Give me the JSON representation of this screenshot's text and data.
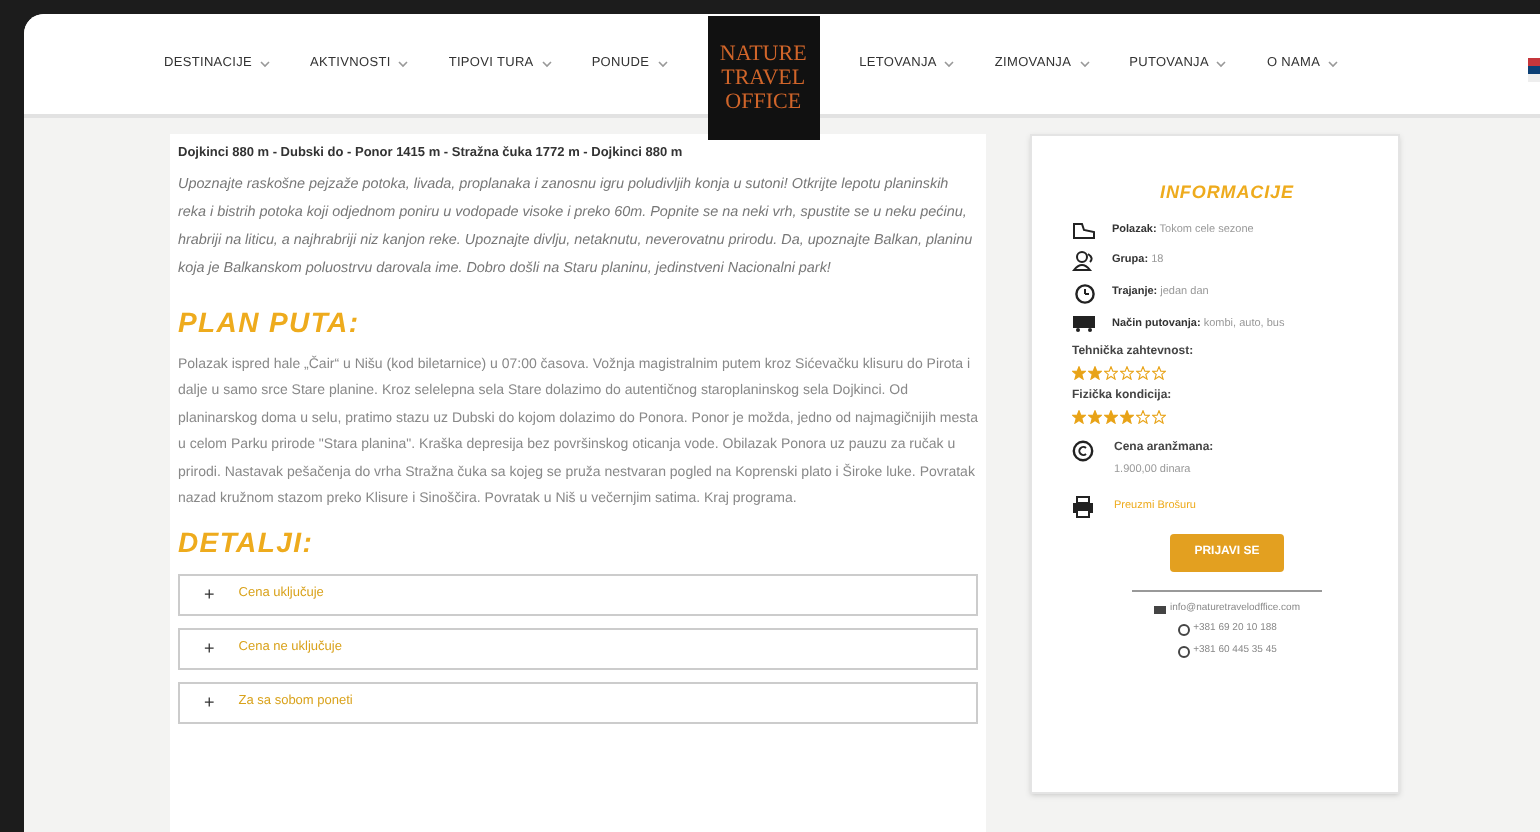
{
  "nav_left": [
    {
      "label": "DESTINACIJE"
    },
    {
      "label": "AKTIVNOSTI"
    },
    {
      "label": "TIPOVI TURA"
    },
    {
      "label": "PONUDE"
    }
  ],
  "logo": [
    "NATURE",
    "TRAVEL",
    "OFFICE"
  ],
  "nav_right": [
    {
      "label": "LETOVANJA"
    },
    {
      "label": "ZIMOVANJA"
    },
    {
      "label": "PUTOVANJA"
    },
    {
      "label": "O NAMA"
    }
  ],
  "route": "Dojkinci 880 m - Dubski do - Ponor 1415  m - Stražna čuka 1772 m - Dojkinci 880 m",
  "intro": "Upoznajte raskošne pejzaže potoka, livada, proplanaka i zanosnu igru poludivljih konja u sutoni! Otkrijte lepotu planinskih reka i bistrih potoka koji odjednom poniru u vodopade visoke i preko 60m. Popnite se na neki vrh, spustite se u neku pećinu, hrabriji na liticu, a najhrabriji niz kanjon reke. Upoznajte divlju, netaknutu, neverovatnu prirodu. Da, upoznajte Balkan, planinu koja je Balkanskom poluostrvu darovala ime. Dobro došli na Staru planinu, jedinstveni Nacionalni park!",
  "plan": {
    "heading": "PLAN PUTA:",
    "text": "Polazak ispred hale „Čair“ u Nišu (kod biletarnice) u 07:00 časova. Vožnja magistralnim putem kroz Sićevačku klisuru do Pirota i dalje u samo srce Stare planine. Kroz selelepna sela Stare dolazimo do autentičnog staroplaninskog sela Dojkinci. Od planinarskog doma u selu, pratimo stazu uz Dubski do kojom dolazimo do Ponora. Ponor je možda, jedno od najmagičnijih mesta u celom Parku prirode \"Stara planina\". Kraška depresija bez površinskog oticanja vode. Obilazak Ponora uz pauzu za ručak u prirodi. Nastavak pešačenja do vrha Stražna čuka sa kojeg se pruža nestvaran pogled na Koprenski plato i Široke luke. Povratak nazad kružnom stazom preko Klisure i Sinoščira. Povratak u Niš u večernjim satima. Kraj programa."
  },
  "details": {
    "heading": "DETALJI:",
    "items": [
      {
        "icon": "+",
        "label": "Cena uključuje",
        "expanded": false
      },
      {
        "icon": "+",
        "label": "Cena ne uključuje",
        "expanded": false
      },
      {
        "icon": "+",
        "label": "Za sa sobom poneti",
        "expanded": false
      }
    ]
  },
  "info": {
    "heading": "INFORMACIJE",
    "rows": [
      {
        "kind": "shoe",
        "label": "Polazak:",
        "value": "Tokom cele sezone"
      },
      {
        "kind": "group",
        "label": "Grupa:",
        "value": "18"
      },
      {
        "kind": "clock",
        "label": "Trajanje:",
        "value": "jedan dan"
      },
      {
        "kind": "bus",
        "label": "Način putovanja:",
        "value": "kombi, auto, bus"
      }
    ],
    "ratings": [
      {
        "label": "Tehnička zahtevnost:",
        "stars": 2
      },
      {
        "label": "Fizička kondicija:",
        "stars": 4
      }
    ],
    "price_label": "Cena aranžmana:",
    "price": "1.900,00 dinara",
    "brochure": "Preuzmi Brošuru",
    "apply": "PRIJAVI SE",
    "email": "info@naturetravelodffice.com",
    "phones": [
      "+381 69 20 10 188",
      "+381 60 445 35 45"
    ]
  }
}
